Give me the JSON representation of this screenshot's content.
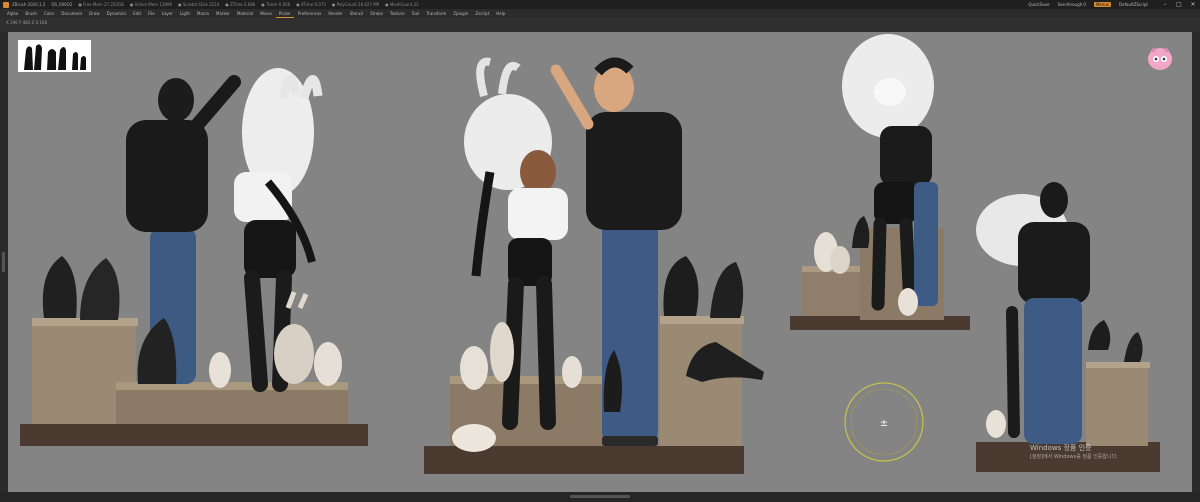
{
  "titlebar": {
    "app_title": "ZBrush 2020.1.2",
    "project": "QS_600O2",
    "stats": [
      "● Free Mem 27.252GB",
      "● Active Mem 11899",
      "● Scratch Disk 2224",
      "● ZTime 2.686",
      "● Timer 0.056",
      "● ATime 0.073",
      "● PolyCount 26.627 MP",
      "● MeshCount 22"
    ],
    "quicksave": "QuickSave",
    "see_through": "See-through  0",
    "menus_badge": "Menus",
    "default_script": "DefaultZScript"
  },
  "menubar": {
    "items": [
      "Alpha",
      "Brush",
      "Color",
      "Document",
      "Draw",
      "Dynamics",
      "Edit",
      "File",
      "Layer",
      "Light",
      "Macro",
      "Marker",
      "Material",
      "Movie",
      "Picker",
      "Preferences",
      "Render",
      "Stencil",
      "Stroke",
      "Texture",
      "Tool",
      "Transform",
      "Zplugin",
      "Zscript",
      "Help"
    ],
    "active_index": 14
  },
  "infobar": {
    "coords": "X 196 Y 482 Z 0.168"
  },
  "watermark": {
    "line1": "Windows 정품 인증",
    "line2": "[설정]에서 Windows를 정품 인증합니다."
  },
  "icons": {
    "thumbnail": "characters-silhouette-thumbnail",
    "avatar": "pink-character-avatar",
    "gizmo": "transpose-gizmo"
  },
  "colors": {
    "accent": "#d98a2b",
    "viewport_bg": "#848484",
    "ui_dark": "#2a2a2a"
  }
}
